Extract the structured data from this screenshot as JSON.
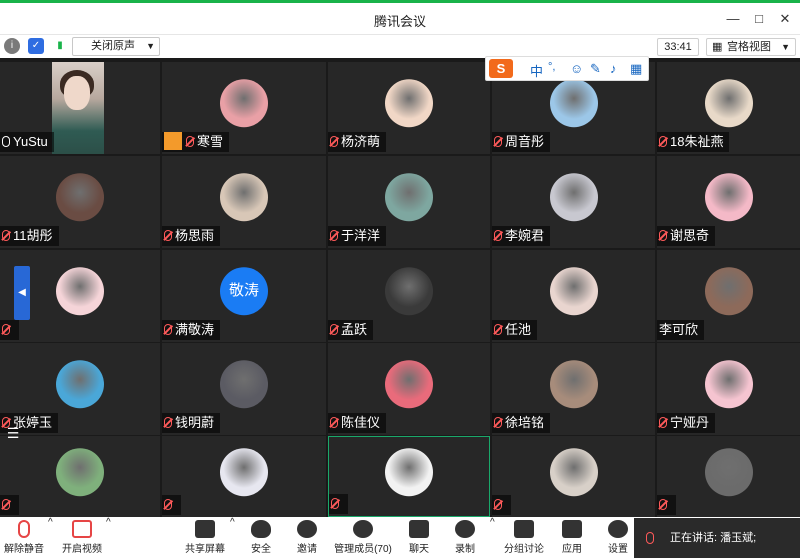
{
  "window": {
    "title": "腾讯会议",
    "min": "—",
    "max": "□",
    "close": "✕"
  },
  "toolbar": {
    "audio_label": "关闭原声",
    "timer": "33:41",
    "view_label": "宫格视图"
  },
  "ime": {
    "logo": "S",
    "mode": "中",
    "punct": "°,",
    "icons": [
      "smile-icon",
      "pen-icon",
      "mic-icon",
      "grid-icon"
    ]
  },
  "participants": [
    {
      "name": "YuStu",
      "muted": false,
      "kind": "video"
    },
    {
      "name": "寒雪",
      "muted": true,
      "kind": "photo",
      "color": "#e9a0a6",
      "host": true
    },
    {
      "name": "杨济萌",
      "muted": true,
      "kind": "photo",
      "color": "#f1d7c6"
    },
    {
      "name": "周音彤",
      "muted": true,
      "kind": "photo",
      "color": "#9cc7e8"
    },
    {
      "name": "18朱祉燕",
      "muted": true,
      "kind": "photo",
      "color": "#e8d9c8"
    },
    {
      "name": "11胡彤",
      "muted": true,
      "kind": "photo",
      "color": "#6a4c43"
    },
    {
      "name": "杨思雨",
      "muted": true,
      "kind": "photo",
      "color": "#d8c7b7"
    },
    {
      "name": "于洋洋",
      "muted": true,
      "kind": "photo",
      "color": "#7ea7a0"
    },
    {
      "name": "李婉君",
      "muted": true,
      "kind": "photo",
      "color": "#c8c8d0"
    },
    {
      "name": "谢思奇",
      "muted": true,
      "kind": "photo",
      "color": "#f4b9c7"
    },
    {
      "name": "",
      "muted": true,
      "kind": "photo",
      "color": "#f5d4d8"
    },
    {
      "name": "满敬涛",
      "muted": true,
      "kind": "text",
      "avatar_text": "敬涛"
    },
    {
      "name": "孟跃",
      "muted": true,
      "kind": "photo",
      "color": "#3a3a3a"
    },
    {
      "name": "任池",
      "muted": true,
      "kind": "photo",
      "color": "#e9d5cf"
    },
    {
      "name": "李可欣",
      "muted": false,
      "kind": "photo",
      "color": "#8d6a5a",
      "no_mic": true
    },
    {
      "name": "张婷玉",
      "muted": true,
      "kind": "photo",
      "color": "#4aa7d8"
    },
    {
      "name": "钱明蔚",
      "muted": true,
      "kind": "photo",
      "color": "#5b5b63"
    },
    {
      "name": "陈佳仪",
      "muted": true,
      "kind": "photo",
      "color": "#e96b7b"
    },
    {
      "name": "徐培铭",
      "muted": true,
      "kind": "photo",
      "color": "#a78c7b"
    },
    {
      "name": "宁娅丹",
      "muted": true,
      "kind": "photo",
      "color": "#f5c4d0"
    },
    {
      "name": "",
      "muted": true,
      "kind": "photo",
      "color": "#7fb07c"
    },
    {
      "name": "",
      "muted": true,
      "kind": "photo",
      "color": "#e7e7f0"
    },
    {
      "name": "",
      "muted": true,
      "kind": "photo",
      "color": "#f2f2f2",
      "highlight": true
    },
    {
      "name": "",
      "muted": true,
      "kind": "photo",
      "color": "#d8d0c8"
    },
    {
      "name": "",
      "muted": true,
      "kind": "photo",
      "color": "#6b6b6b"
    }
  ],
  "bottom": {
    "mute": "解除静音",
    "video": "开启视频",
    "share": "共享屏幕",
    "security": "安全",
    "invite": "邀请",
    "members": "管理成员(70)",
    "chat": "聊天",
    "record": "录制",
    "breakout": "分组讨论",
    "apps": "应用",
    "settings": "设置"
  },
  "speaking": {
    "text": "正在讲话: 潘玉斌;"
  }
}
